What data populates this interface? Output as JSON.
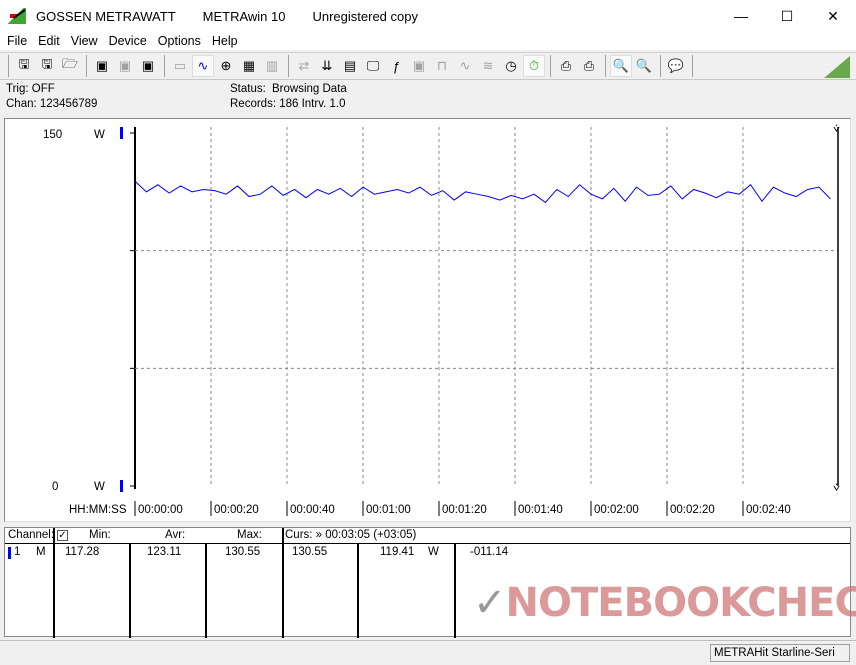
{
  "titlebar": {
    "brand": "GOSSEN METRAWATT",
    "app": "METRAwin 10",
    "license": "Unregistered copy",
    "minimize": "—",
    "maximize": "☐",
    "close": "✕"
  },
  "menu": [
    "File",
    "Edit",
    "View",
    "Device",
    "Options",
    "Help"
  ],
  "toolbar": [
    "save-as-icon",
    "save-icon",
    "open-icon",
    "device-read-icon",
    "device-read-disabled-icon",
    "device-memory-icon",
    "display-icon",
    "waveform-icon",
    "crosshair-icon",
    "table-icon",
    "bar-view-icon",
    "transfer-icon",
    "download-icon",
    "logger-icon",
    "monitor-icon",
    "function-icon",
    "device-disabled-icon",
    "trigger-icon",
    "wave-disabled-icon",
    "multi-wave-icon",
    "clock-icon",
    "stopwatch-icon",
    "print-icon",
    "printer-icon",
    "zoom-wave-icon",
    "zoom-peak-icon",
    "comment-icon"
  ],
  "info": {
    "trig": "Trig: OFF",
    "chan": "Chan:  123456789",
    "status_label": "Status:",
    "status_value": "Browsing Data",
    "records": "Records: 186   Intrv. 1.0"
  },
  "chart_data": {
    "type": "line",
    "title": "",
    "xlabel": "HH:MM:SS",
    "ylabel": "",
    "y_unit": "W",
    "ylim": [
      0,
      150
    ],
    "y_tick_labels": [
      "150",
      "0"
    ],
    "xlim": [
      0,
      185
    ],
    "x_tick_labels": [
      "00:00:00",
      "00:00:20",
      "00:00:40",
      "00:01:00",
      "00:01:20",
      "00:01:40",
      "00:02:00",
      "00:02:20",
      "00:02:40"
    ],
    "grid": true,
    "series_color": "#0000ff",
    "x": [
      0,
      3,
      6,
      9,
      12,
      15,
      18,
      21,
      24,
      27,
      30,
      33,
      36,
      39,
      42,
      45,
      48,
      51,
      54,
      57,
      60,
      63,
      66,
      69,
      72,
      75,
      78,
      81,
      84,
      87,
      90,
      93,
      96,
      99,
      102,
      105,
      108,
      111,
      114,
      117,
      120,
      123,
      126,
      129,
      132,
      135,
      138,
      141,
      144,
      147,
      150,
      153,
      156,
      159,
      162,
      165,
      168,
      171,
      174,
      177,
      180,
      183
    ],
    "values": [
      129.5,
      125,
      128,
      124.5,
      127.5,
      125,
      126,
      125.5,
      124,
      127.5,
      123,
      124,
      127.5,
      123.5,
      126,
      122.5,
      126,
      124,
      126.5,
      123,
      127,
      124,
      125,
      126,
      124.5,
      127,
      123.5,
      125.5,
      121.5,
      125,
      124,
      123,
      121.5,
      123.5,
      122,
      124,
      120.5,
      126,
      123,
      128,
      124,
      122,
      126.5,
      121,
      127,
      123.5,
      124,
      127.5,
      122,
      126,
      124.5,
      122.5,
      125,
      124,
      128,
      121,
      127,
      124.5,
      123,
      126,
      127,
      122
    ]
  },
  "table": {
    "headers": {
      "channel": "Channel:",
      "min": "Min:",
      "avr": "Avr:",
      "max": "Max:",
      "cursor": "Curs: » 00:03:05 (+03:05)"
    },
    "rows": [
      {
        "channel": "1",
        "mode": "M",
        "min": "117.28",
        "avr": "123.11",
        "max": "130.55",
        "cursor_max": "130.55",
        "cursor_value": "119.41",
        "unit": "W",
        "delta": "-011.14"
      }
    ]
  },
  "status": {
    "device": "METRAHit Starline-Seri"
  },
  "watermark": "NOTEBOOKCHECK"
}
